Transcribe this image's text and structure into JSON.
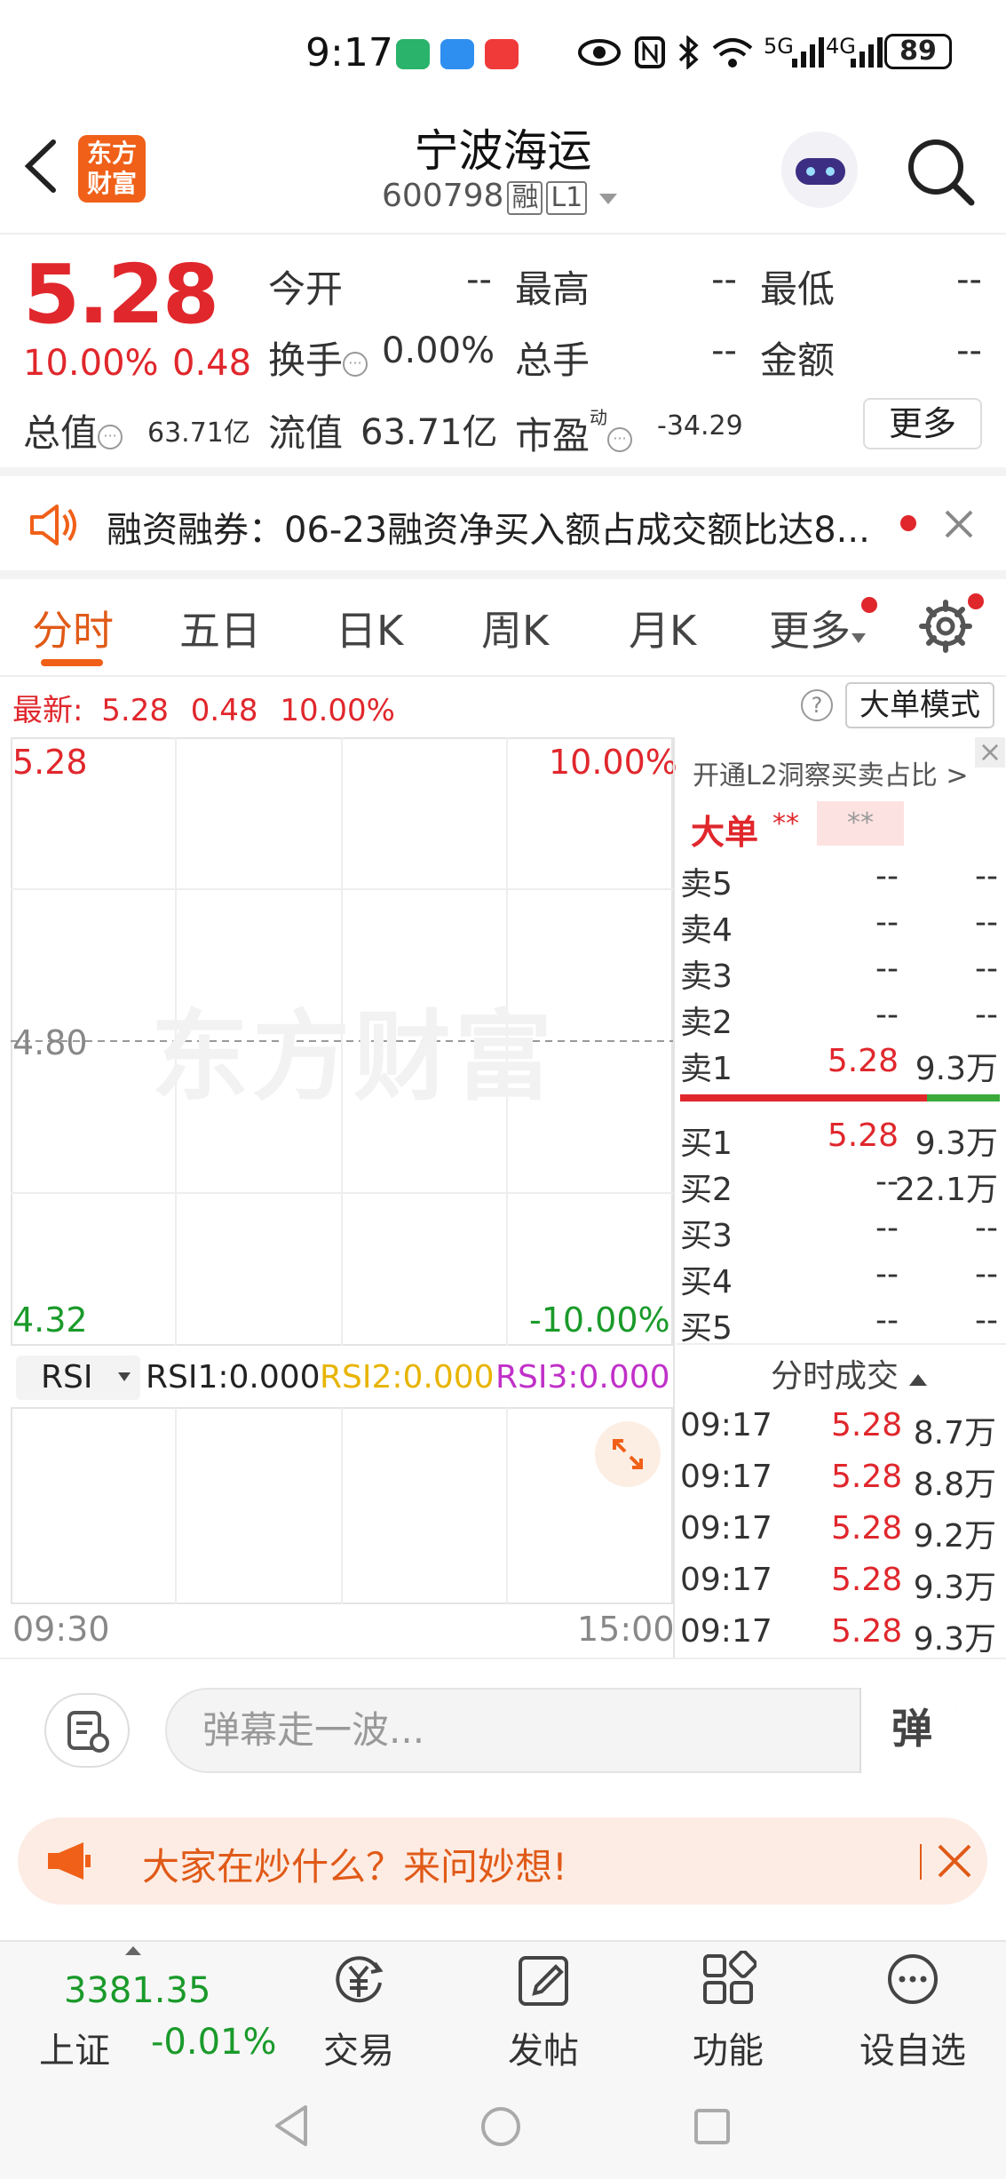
{
  "status_bar": {
    "time": "9:17",
    "battery": "89",
    "signal1": "5G",
    "signal2": "4G"
  },
  "header": {
    "logo_text": "东方\n财富",
    "stock_name": "宁波海运",
    "stock_code": "600798",
    "tag_margin": "融",
    "tag_level": "L1"
  },
  "quote": {
    "price": "5.28",
    "change_pct": "10.00%",
    "change_abs": "0.48",
    "open_label": "今开",
    "open_value": "--",
    "high_label": "最高",
    "high_value": "--",
    "low_label": "最低",
    "low_value": "--",
    "turnover_label": "换手",
    "turnover_value": "0.00%",
    "volume_label": "总手",
    "volume_value": "--",
    "amount_label": "金额",
    "amount_value": "--",
    "mktcap_label": "总值",
    "mktcap_value": "63.71亿",
    "float_label": "流值",
    "float_value": "63.71亿",
    "pe_label": "市盈",
    "pe_sup": "动",
    "pe_value": "-34.29",
    "more_label": "更多"
  },
  "ticker": {
    "text": "融资融券：06-23融资净买入额占成交额比达8..."
  },
  "tabs": [
    {
      "label": "分时"
    },
    {
      "label": "五日"
    },
    {
      "label": "日K"
    },
    {
      "label": "周K"
    },
    {
      "label": "月K"
    },
    {
      "label": "更多"
    }
  ],
  "latest": {
    "label": "最新:",
    "price": "5.28",
    "change": "0.48",
    "pct": "10.00%",
    "big_order_mode": "大单模式"
  },
  "chart": {
    "top_price": "5.28",
    "top_pct": "10.00%",
    "mid_price": "4.80",
    "bottom_price": "4.32",
    "bottom_pct": "-10.00%",
    "watermark": "东方财富",
    "time_start": "09:30",
    "time_end": "15:00"
  },
  "rsi": {
    "selector": "RSI",
    "rsi1": "RSI1:0.000",
    "rsi2": "RSI2:0.000",
    "rsi3": "RSI3:0.000",
    "colors": {
      "rsi1": "#222222",
      "rsi2": "#e8b400",
      "rsi3": "#c030c8"
    }
  },
  "order_book": {
    "l2_link": "开通L2洞察买卖占比 >",
    "big_label": "大单",
    "big_stars1": "**",
    "big_stars2": "**",
    "asks": [
      {
        "label": "卖5",
        "price": "--",
        "volume": "--"
      },
      {
        "label": "卖4",
        "price": "--",
        "volume": "--"
      },
      {
        "label": "卖3",
        "price": "--",
        "volume": "--"
      },
      {
        "label": "卖2",
        "price": "--",
        "volume": "--"
      },
      {
        "label": "卖1",
        "price": "5.28",
        "volume": "9.3万"
      }
    ],
    "bids": [
      {
        "label": "买1",
        "price": "5.28",
        "volume": "9.3万"
      },
      {
        "label": "买2",
        "price": "--",
        "volume": "22.1万"
      },
      {
        "label": "买3",
        "price": "--",
        "volume": "--"
      },
      {
        "label": "买4",
        "price": "--",
        "volume": "--"
      },
      {
        "label": "买5",
        "price": "--",
        "volume": "--"
      }
    ],
    "trades_title": "分时成交",
    "trades": [
      {
        "time": "09:17",
        "price": "5.28",
        "volume": "8.7万"
      },
      {
        "time": "09:17",
        "price": "5.28",
        "volume": "8.8万"
      },
      {
        "time": "09:17",
        "price": "5.28",
        "volume": "9.2万"
      },
      {
        "time": "09:17",
        "price": "5.28",
        "volume": "9.3万"
      },
      {
        "time": "09:17",
        "price": "5.28",
        "volume": "9.3万"
      }
    ]
  },
  "comment": {
    "placeholder": "弹幕走一波...",
    "send_label": "弹"
  },
  "promo": {
    "text": "大家在炒什么？来问妙想!"
  },
  "bottom_nav": {
    "index_value": "3381.35",
    "index_name": "上证",
    "index_change": "-0.01%",
    "items": [
      {
        "label": "交易"
      },
      {
        "label": "发帖"
      },
      {
        "label": "功能"
      },
      {
        "label": "设自选"
      }
    ]
  }
}
